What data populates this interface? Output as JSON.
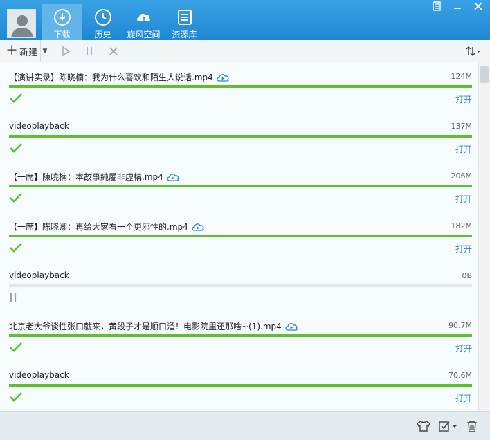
{
  "nav": {
    "tabs": [
      {
        "label": "下载",
        "icon": "download-icon",
        "active": true
      },
      {
        "label": "历史",
        "icon": "history-icon",
        "active": false
      },
      {
        "label": "旋风空间",
        "icon": "cloud-icon",
        "active": false
      },
      {
        "label": "资源库",
        "icon": "library-icon",
        "active": false
      }
    ]
  },
  "toolbar": {
    "new_label": "新建"
  },
  "downloads": [
    {
      "title": "【演讲实录】陈晓楠：我为什么喜欢和陌生人说话.mp4",
      "size": "124M",
      "progress": 1.0,
      "status": "complete",
      "action": "打开",
      "cloud": true
    },
    {
      "title": "videoplayback",
      "size": "137M",
      "progress": 1.0,
      "status": "complete",
      "action": "打开",
      "cloud": false
    },
    {
      "title": "【一席】陳曉楠：本故事純屬非虛構.mp4",
      "size": "206M",
      "progress": 1.0,
      "status": "complete",
      "action": "打开",
      "cloud": true
    },
    {
      "title": "【一席】陈晓卿：再给大家看一个更邪性的.mp4",
      "size": "182M",
      "progress": 1.0,
      "status": "complete",
      "action": "打开",
      "cloud": true
    },
    {
      "title": "videoplayback",
      "size": "0B",
      "progress": 0.0,
      "status": "paused",
      "action": "",
      "cloud": false
    },
    {
      "title": "北京老大爷谈性张口就来，黄段子才是顺口溜！电影院里还那啥~(1).mp4",
      "size": "90.7M",
      "progress": 1.0,
      "status": "complete",
      "action": "打开",
      "cloud": true
    },
    {
      "title": "videoplayback",
      "size": "70.6M",
      "progress": 1.0,
      "status": "complete",
      "action": "打开",
      "cloud": false
    }
  ],
  "colors": {
    "accent": "#1e87d2",
    "progress": "#5fc02c",
    "link": "#2b83cf"
  }
}
